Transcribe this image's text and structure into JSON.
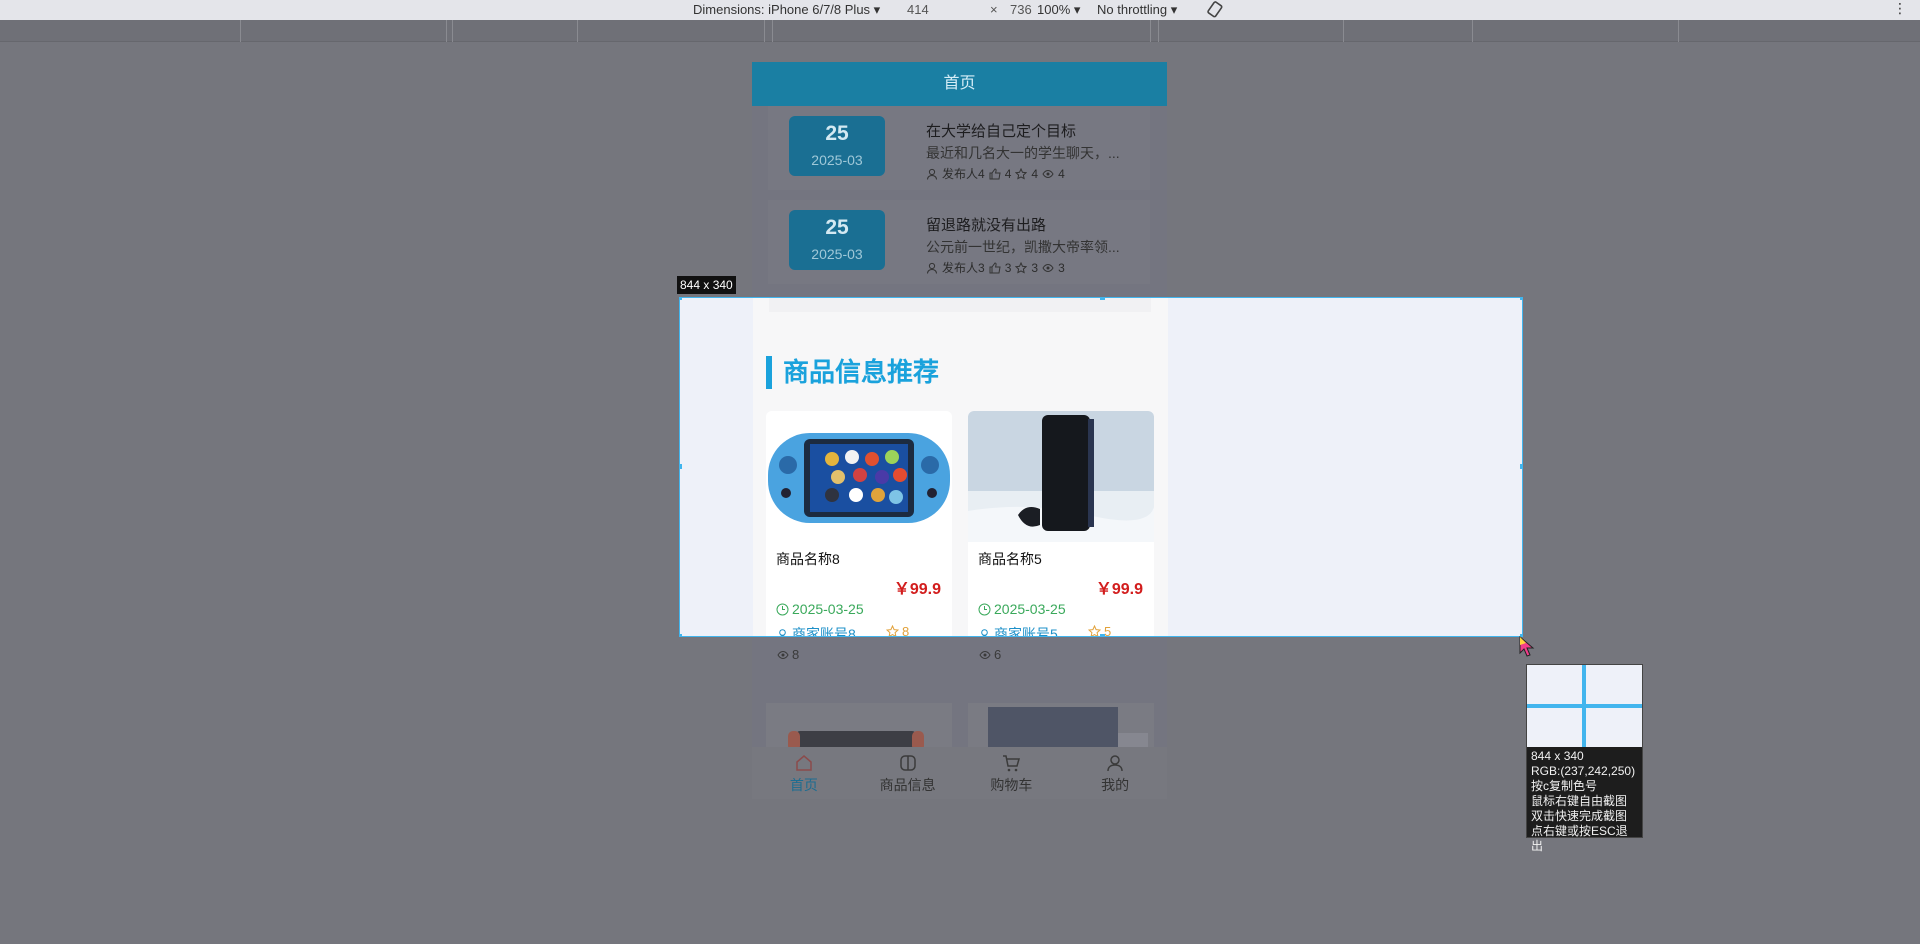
{
  "devtools": {
    "dimensions": "Dimensions: iPhone 6/7/8 Plus ▾",
    "width": "414",
    "times": "×",
    "height": "736",
    "zoom": "100% ▾",
    "throttling": "No throttling ▾",
    "more": "⋮"
  },
  "app": {
    "header_title": "首页",
    "news": [
      {
        "day": "25",
        "month": "2025-03",
        "title": "在大学给自己定个目标",
        "desc": "最近和几名大一的学生聊天，...",
        "author": "发布人4",
        "likes": "4",
        "favs": "4",
        "views": "4"
      },
      {
        "day": "25",
        "month": "2025-03",
        "title": "留退路就没有出路",
        "desc": "公元前一世纪，凯撒大帝率领...",
        "author": "发布人3",
        "likes": "3",
        "favs": "3",
        "views": "3"
      }
    ],
    "section_title": "商品信息推荐",
    "goods": [
      {
        "name": "商品名称8",
        "price": "￥99.9",
        "date": "2025-03-25",
        "shop": "商家账号8",
        "favs": "8",
        "views": "8"
      },
      {
        "name": "商品名称5",
        "price": "￥99.9",
        "date": "2025-03-25",
        "shop": "商家账号5",
        "favs": "5",
        "views": "6"
      }
    ],
    "tabs": [
      {
        "label": "首页",
        "icon": "home-icon",
        "active": true
      },
      {
        "label": "商品信息",
        "icon": "goods-icon",
        "active": false
      },
      {
        "label": "购物车",
        "icon": "cart-icon",
        "active": false
      },
      {
        "label": "我的",
        "icon": "user-icon",
        "active": false
      }
    ]
  },
  "capture": {
    "size_label": "844 x 340",
    "magnifier_lines": [
      "844 x 340",
      "RGB:(237,242,250)",
      "按c复制色号",
      "鼠标右键自由截图",
      "双击快速完成截图",
      "点右键或按ESC退出"
    ]
  },
  "colors": {
    "accent": "#1aa2dc",
    "price": "#d21d1d",
    "selection_border": "#41b5ee",
    "selection_fill": "#eef1f9"
  }
}
